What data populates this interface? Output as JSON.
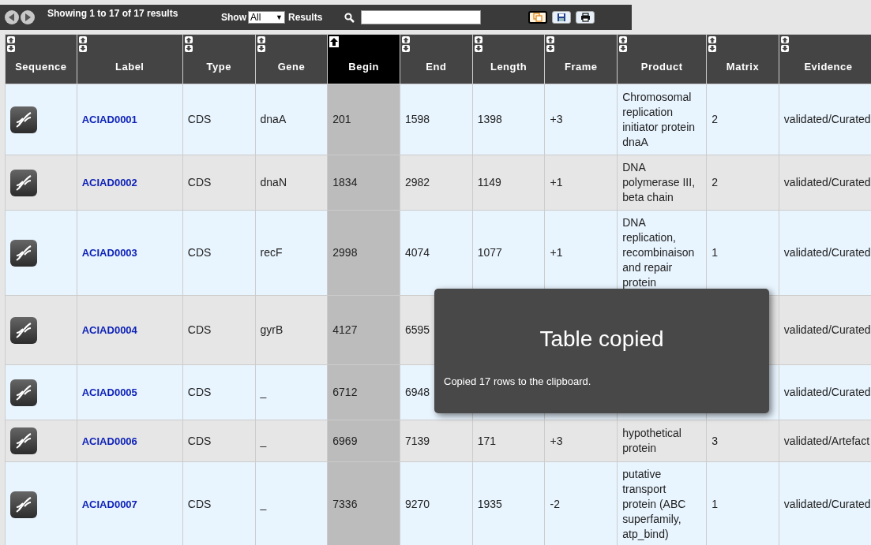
{
  "toolbar": {
    "summary": "Showing 1 to 17 of 17 results",
    "show_label": "Show",
    "show_value": "All",
    "show_caret": "▼",
    "results_label": "Results"
  },
  "columns": [
    {
      "label": "Sequence",
      "sorted": false
    },
    {
      "label": "Label",
      "sorted": false
    },
    {
      "label": "Type",
      "sorted": false
    },
    {
      "label": "Gene",
      "sorted": false
    },
    {
      "label": "Begin",
      "sorted": true
    },
    {
      "label": "End",
      "sorted": false
    },
    {
      "label": "Length",
      "sorted": false
    },
    {
      "label": "Frame",
      "sorted": false
    },
    {
      "label": "Product",
      "sorted": false
    },
    {
      "label": "Matrix",
      "sorted": false
    },
    {
      "label": "Evidence",
      "sorted": false
    }
  ],
  "rows": [
    {
      "label": "ACIAD0001",
      "type": "CDS",
      "gene": "dnaA",
      "begin": "201",
      "end": "1598",
      "length": "1398",
      "frame": "+3",
      "product": "Chromosomal replication initiator protein dnaA",
      "matrix": "2",
      "evidence": "validated/Curated"
    },
    {
      "label": "ACIAD0002",
      "type": "CDS",
      "gene": "dnaN",
      "begin": "1834",
      "end": "2982",
      "length": "1149",
      "frame": "+1",
      "product": "DNA polymerase III, beta chain",
      "matrix": "2",
      "evidence": "validated/Curated"
    },
    {
      "label": "ACIAD0003",
      "type": "CDS",
      "gene": "recF",
      "begin": "2998",
      "end": "4074",
      "length": "1077",
      "frame": "+1",
      "product": "DNA replication, recombinaison and repair protein",
      "matrix": "1",
      "evidence": "validated/Curated"
    },
    {
      "label": "ACIAD0004",
      "type": "CDS",
      "gene": "gyrB",
      "begin": "4127",
      "end": "6595",
      "evidence": "validated/Curated"
    },
    {
      "label": "ACIAD0005",
      "type": "CDS",
      "gene": "_",
      "begin": "6712",
      "end": "6948",
      "evidence": "validated/Curated"
    },
    {
      "label": "ACIAD0006",
      "type": "CDS",
      "gene": "_",
      "begin": "6969",
      "end": "7139",
      "length": "171",
      "frame": "+3",
      "product": "hypothetical protein",
      "matrix": "3",
      "evidence": "validated/Artefact"
    },
    {
      "label": "ACIAD0007",
      "type": "CDS",
      "gene": "_",
      "begin": "7336",
      "end": "9270",
      "length": "1935",
      "frame": "-2",
      "product": "putative transport protein (ABC superfamily, atp_bind)",
      "matrix": "1",
      "evidence": "validated/Curated"
    }
  ],
  "toast": {
    "title": "Table copied",
    "message": "Copied 17 rows to the clipboard."
  }
}
